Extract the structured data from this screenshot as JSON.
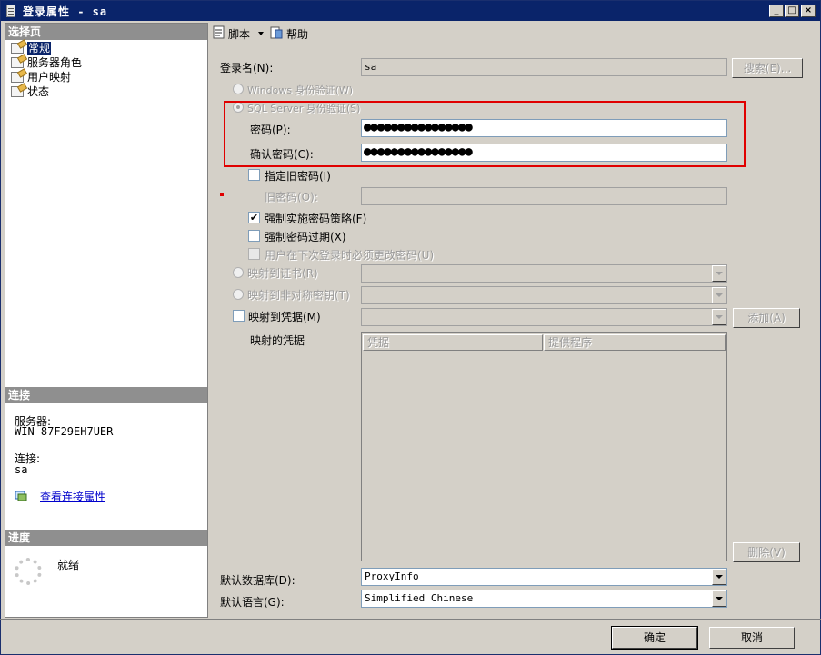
{
  "window": {
    "title": "登录属性 - sa",
    "minimize": "_",
    "maximize": "□",
    "close": "×"
  },
  "left": {
    "select_page_header": "选择页",
    "nav_items": [
      "常规",
      "服务器角色",
      "用户映射",
      "状态"
    ],
    "connection_header": "连接",
    "server_label": "服务器:",
    "server_value": "WIN-87F29EH7UER",
    "connection_label": "连接:",
    "connection_value": "sa",
    "view_props_link": "查看连接属性",
    "progress_header": "进度",
    "progress_status": "就绪"
  },
  "toolbar": {
    "script_label": "脚本",
    "help_label": "帮助"
  },
  "form": {
    "login_name_label": "登录名(N):",
    "login_name_value": "sa",
    "search_button": "搜索(E)...",
    "windows_auth_label": "Windows 身份验证(W)",
    "sql_auth_label": "SQL Server 身份验证(S)",
    "password_label": "密码(P):",
    "password_value": "●●●●●●●●●●●●●●●●",
    "confirm_password_label": "确认密码(C):",
    "confirm_password_value": "●●●●●●●●●●●●●●●●",
    "specify_old_password_label": "指定旧密码(I)",
    "old_password_label": "旧密码(O):",
    "enforce_policy_label": "强制实施密码策略(F)",
    "enforce_expiration_label": "强制密码过期(X)",
    "must_change_label": "用户在下次登录时必须更改密码(U)",
    "map_certificate_label": "映射到证书(R)",
    "map_asymmetric_label": "映射到非对称密钥(T)",
    "map_credential_label": "映射到凭据(M)",
    "add_button": "添加(A)",
    "mapped_credentials_label": "映射的凭据",
    "grid_col_credential": "凭据",
    "grid_col_provider": "提供程序",
    "remove_button": "删除(V)",
    "default_db_label": "默认数据库(D):",
    "default_db_value": "ProxyInfo",
    "default_lang_label": "默认语言(G):",
    "default_lang_value": "Simplified Chinese"
  },
  "footer": {
    "ok_button": "确定",
    "cancel_button": "取消"
  },
  "state": {
    "enforce_policy_checked": "✔",
    "highlight_color": "#e00000"
  }
}
